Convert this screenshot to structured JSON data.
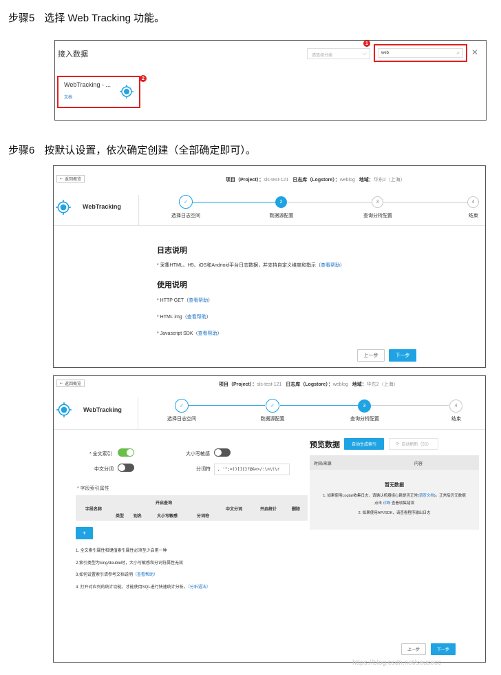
{
  "step5": {
    "num": "步骤5",
    "text": "选择 Web Tracking 功能。"
  },
  "step6": {
    "num": "步骤6",
    "text": "按默认设置，依次确定创建（全部确定即可）。"
  },
  "panel1": {
    "title": "接入数据",
    "category_placeholder": "请选择分类",
    "search_value": "web",
    "card_title": "WebTracking - ...",
    "card_link": "文档",
    "markers": [
      "1",
      "2"
    ]
  },
  "header": {
    "back": "返回概览",
    "project_label": "项目（Project）：",
    "project_value": "sls-test-121",
    "logstore_label": "日志库（Logstore）：",
    "logstore_value": "weblog",
    "region_label": "地域：",
    "region_value": "华东2（上海）",
    "app_name": "WebTracking"
  },
  "steps": [
    {
      "n": "1",
      "label": "选择日志空间"
    },
    {
      "n": "2",
      "label": "数据源配置"
    },
    {
      "n": "3",
      "label": "查询分析配置"
    },
    {
      "n": "4",
      "label": "结束"
    }
  ],
  "check": "✓",
  "panel2": {
    "h1": "日志说明",
    "desc_pre": "* 采集HTML、H5、iOS和Andrioid平台日志数据，并支持自定义维度和指示（",
    "help": "查看帮助",
    "desc_post": "）",
    "h2": "使用说明",
    "items": [
      {
        "pre": "* HTTP GET（",
        "post": "）"
      },
      {
        "pre": "* HTML img（",
        "post": "）"
      },
      {
        "pre": "* Javascript SDK（",
        "post": "）"
      }
    ],
    "prev": "上一步",
    "next": "下一步"
  },
  "panel3": {
    "fulltext": "全文索引",
    "case": "大小写敏感",
    "cn_seg": "中文分词",
    "delim_label": "分词符",
    "delim_value": ", '\";=()[]{}?@&<>/:\\n\\t\\r",
    "field_title": "字段索引属性",
    "cols": {
      "field": "字段名称",
      "enable_query": "开启查询",
      "type": "类型",
      "alias": "别名",
      "case": "大小写敏感",
      "delim": "分词符",
      "cn": "中文分词",
      "stats": "开启统计",
      "del": "删除"
    },
    "add": "+",
    "notes": [
      "1. 全文索引属性和键值索引属性必须至少启用一种",
      "2.索引类型为long/double时，大小写敏感和分词符属性无效",
      "3.如何设置索引请参考文档说明",
      "4. 打开对应列的统计功能，才能使用SQL进行快速统计分析。"
    ],
    "note3_link": "（查看帮助）",
    "note4_link": "（分析语法）",
    "preview_title": "预览数据",
    "auto_index": "自动生成索引",
    "auto_refresh": "自动刷新（5S）",
    "col_time": "时间/来源",
    "col_content": "内容",
    "empty_title": "暂无数据",
    "empty_1a": "1. 如果使用Logtail收集日志，请确认机器组心跳是否正常(",
    "empty_1_link": "调查文档",
    "empty_1b": ")。正常后仍无数据",
    "empty_1c_pre": "点击 ",
    "empty_1c_link": "诊断",
    "empty_1c_post": " 查看收集错误",
    "empty_2": "2. 如果使用API/SDK，请查看程序输出日志",
    "prev": "上一步",
    "next": "下一步"
  },
  "watermark": "https://blog.csdn.net/seusecc"
}
